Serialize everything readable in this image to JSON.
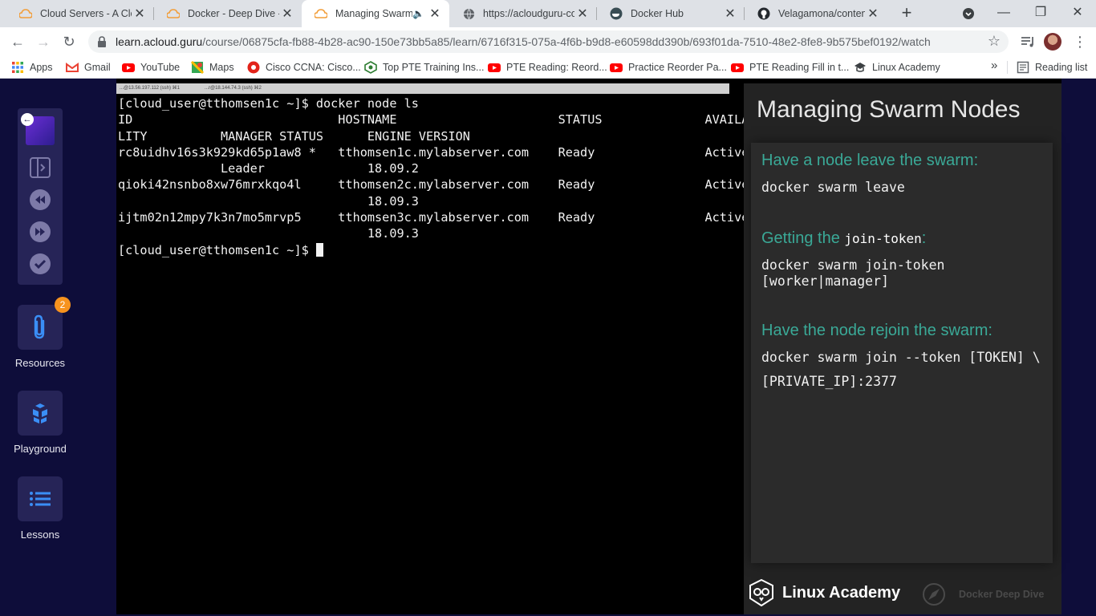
{
  "browser": {
    "tabs": [
      {
        "title": "Cloud Servers - A Clou",
        "icon": "acloudguru-icon"
      },
      {
        "title": "Docker - Deep Dive - A",
        "icon": "acloudguru-icon"
      },
      {
        "title": "Managing Swarm",
        "icon": "acloudguru-icon",
        "active": true
      },
      {
        "title": "https://acloudguru-co",
        "icon": "globe-icon"
      },
      {
        "title": "Docker Hub",
        "icon": "docker-icon"
      },
      {
        "title": "Velagamona/content-",
        "icon": "github-icon"
      }
    ],
    "url_host": "learn.acloud.guru",
    "url_path": "/course/06875cfa-fb88-4b28-ac90-150e73bb5a85/learn/6716f315-075a-4f6b-b9d8-e60598dd390b/693f01da-7510-48e2-8fe8-9b575bef0192/watch",
    "bookmarks": [
      {
        "label": "Apps",
        "icon": "apps-grid-icon"
      },
      {
        "label": "Gmail",
        "icon": "gmail-icon"
      },
      {
        "label": "YouTube",
        "icon": "youtube-icon"
      },
      {
        "label": "Maps",
        "icon": "maps-icon"
      },
      {
        "label": "Cisco CCNA: Cisco...",
        "icon": "cisco-icon"
      },
      {
        "label": "Top PTE Training Ins...",
        "icon": "pte-icon"
      },
      {
        "label": "PTE Reading: Reord...",
        "icon": "youtube-icon"
      },
      {
        "label": "Practice Reorder Pa...",
        "icon": "youtube-icon"
      },
      {
        "label": "PTE Reading Fill in t...",
        "icon": "youtube-icon"
      },
      {
        "label": "Linux Academy",
        "icon": "grad-cap-icon"
      }
    ],
    "more_bookmarks": "»",
    "reading_list": "Reading list"
  },
  "sidebar": {
    "resources_label": "Resources",
    "resources_badge": "2",
    "playground_label": "Playground",
    "lessons_label": "Lessons"
  },
  "terminal": {
    "tab1": "...@13.56.197.112 (ssh)  ⌘1",
    "tab2": "...r@18.144.74.3 (ssh)  ⌘2",
    "lines": [
      "[cloud_user@tthomsen1c ~]$ docker node ls",
      "ID                            HOSTNAME                      STATUS              AVAILABI",
      "LITY          MANAGER STATUS      ENGINE VERSION",
      "rc8uidhv16s3k929kd65p1aw8 *   tthomsen1c.mylabserver.com    Ready               Active",
      "              Leader              18.09.2",
      "qioki42nsnbo8xw76mrxkqo4l     tthomsen2c.mylabserver.com    Ready               Active",
      "                                  18.09.3",
      "ijtm02n12mpy7k3n7mo5mrvp5     tthomsen3c.mylabserver.com    Ready               Active",
      "                                  18.09.3",
      "[cloud_user@tthomsen1c ~]$ "
    ]
  },
  "slide": {
    "title": "Managing Swarm Nodes",
    "heading1": "Have a node leave the swarm:",
    "cmd1": "docker swarm leave",
    "heading2_prefix": "Getting the ",
    "heading2_code": "join-token",
    "heading2_suffix": ":",
    "cmd2": "docker swarm join-token\n[worker|manager]",
    "heading3": "Have the node rejoin the swarm:",
    "cmd3": "docker swarm join --token [TOKEN] \\\n\n[PRIVATE_IP]:2377",
    "brand": "Linux Academy",
    "course": "Docker Deep Dive"
  },
  "colors": {
    "accent_teal": "#3aa997",
    "sidebar_bg": "#0e0d3a",
    "tile_bg": "#262457",
    "badge_orange": "#f7931e"
  }
}
